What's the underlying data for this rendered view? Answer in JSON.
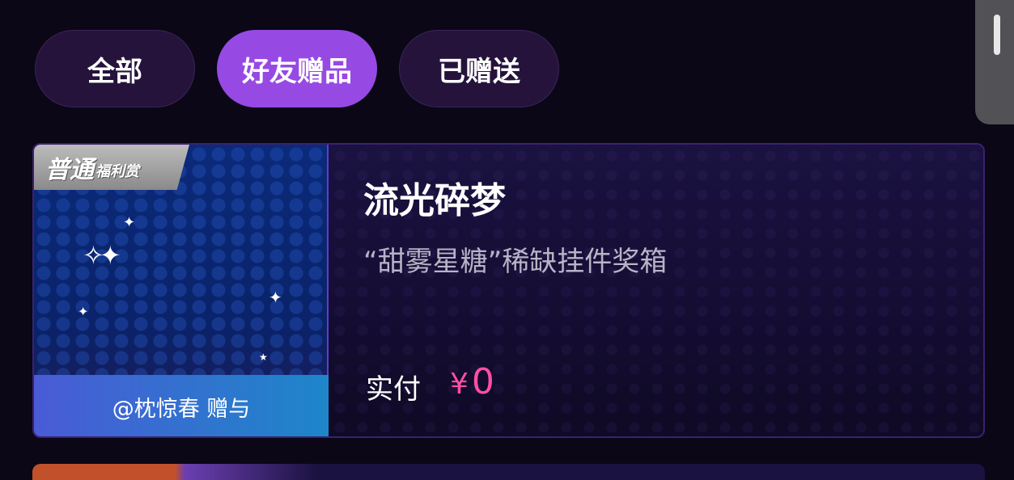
{
  "tabs": [
    {
      "label": "全部",
      "active": false
    },
    {
      "label": "好友赠品",
      "active": true
    },
    {
      "label": "已赠送",
      "active": false
    }
  ],
  "colors": {
    "background": "#0b0716",
    "tab_active": "#9749e4",
    "tab_inactive": "#25133c",
    "price": "#ff4fa3",
    "sender_gradient_start": "#4a5bd6",
    "sender_gradient_end": "#1d86c9"
  },
  "gift_card": {
    "badge_main": "普通",
    "badge_sub": "福利赏",
    "sender_text": "@枕惊春 赠与",
    "title": "流光碎梦",
    "description": "“甜雾星糖”稀缺挂件奖箱",
    "paid_label": "实付",
    "currency_symbol": "¥",
    "price": "0"
  }
}
